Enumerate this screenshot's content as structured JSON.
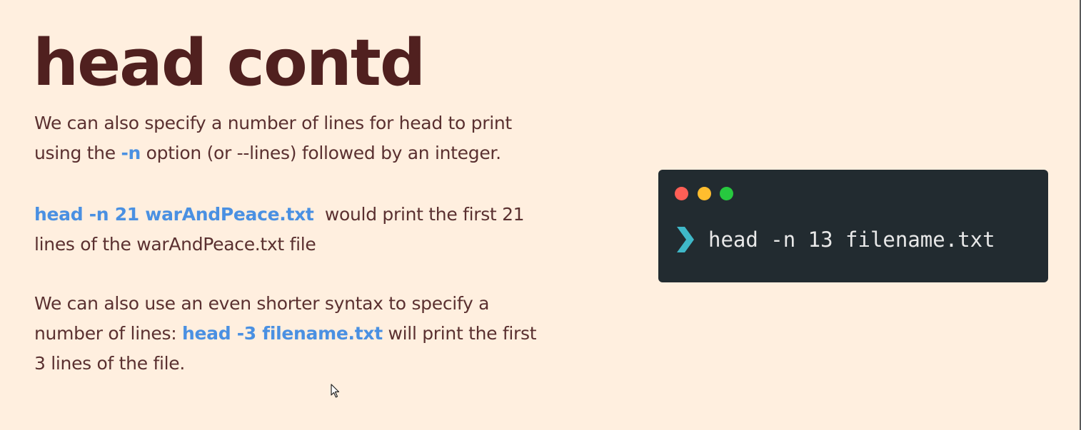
{
  "slide": {
    "title": "head contd",
    "paragraph1": {
      "line1": "We can also specify a number of lines for head to print",
      "line2_before": "using the ",
      "line2_code": "-n",
      "line2_after": " option (or --lines) followed by an integer."
    },
    "paragraph2": {
      "line1_code": "head -n 21 warAndPeace.txt",
      "line1_after": "  would print the first 21",
      "line2": "lines of the warAndPeace.txt file"
    },
    "paragraph3": {
      "line1": "We can also use an even shorter syntax to specify a",
      "line2_before": "number of lines: ",
      "line2_code": "head -3 filename.txt",
      "line2_after": " will print the first",
      "line3": "3 lines of the file."
    }
  },
  "terminal": {
    "command": "head -n 13 filename.txt",
    "window_buttons": [
      "close",
      "minimize",
      "maximize"
    ],
    "prompt_icon": "chevron-right-icon"
  },
  "colors": {
    "background": "#ffefdf",
    "title": "#50201f",
    "body_text": "#5a3030",
    "code_highlight": "#4a90e2",
    "terminal_bg": "#222b30",
    "terminal_text": "#e8e8e8",
    "prompt": "#3fb8c8",
    "dot_red": "#ff5f56",
    "dot_yellow": "#ffbd2e",
    "dot_green": "#27c93f"
  }
}
